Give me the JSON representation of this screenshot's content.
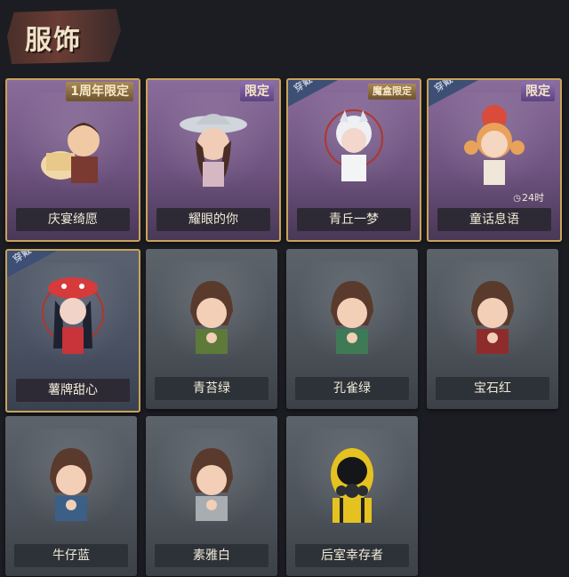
{
  "header": {
    "title": "服饰"
  },
  "items": [
    {
      "name": "庆宴绮愿",
      "tag": "1周年限定"
    },
    {
      "name": "耀眼的你",
      "tag": "限定"
    },
    {
      "name": "青丘一梦",
      "tag": "魔盒限定",
      "badge": "穿戴"
    },
    {
      "name": "童话息语",
      "tag": "限定",
      "badge": "穿戴",
      "timer": "24时"
    },
    {
      "name": "薯牌甜心",
      "badge": "穿戴"
    },
    {
      "name": "青苔绿"
    },
    {
      "name": "孔雀绿"
    },
    {
      "name": "宝石红"
    },
    {
      "name": "牛仔蓝"
    },
    {
      "name": "素雅白"
    },
    {
      "name": "后室幸存者"
    }
  ]
}
